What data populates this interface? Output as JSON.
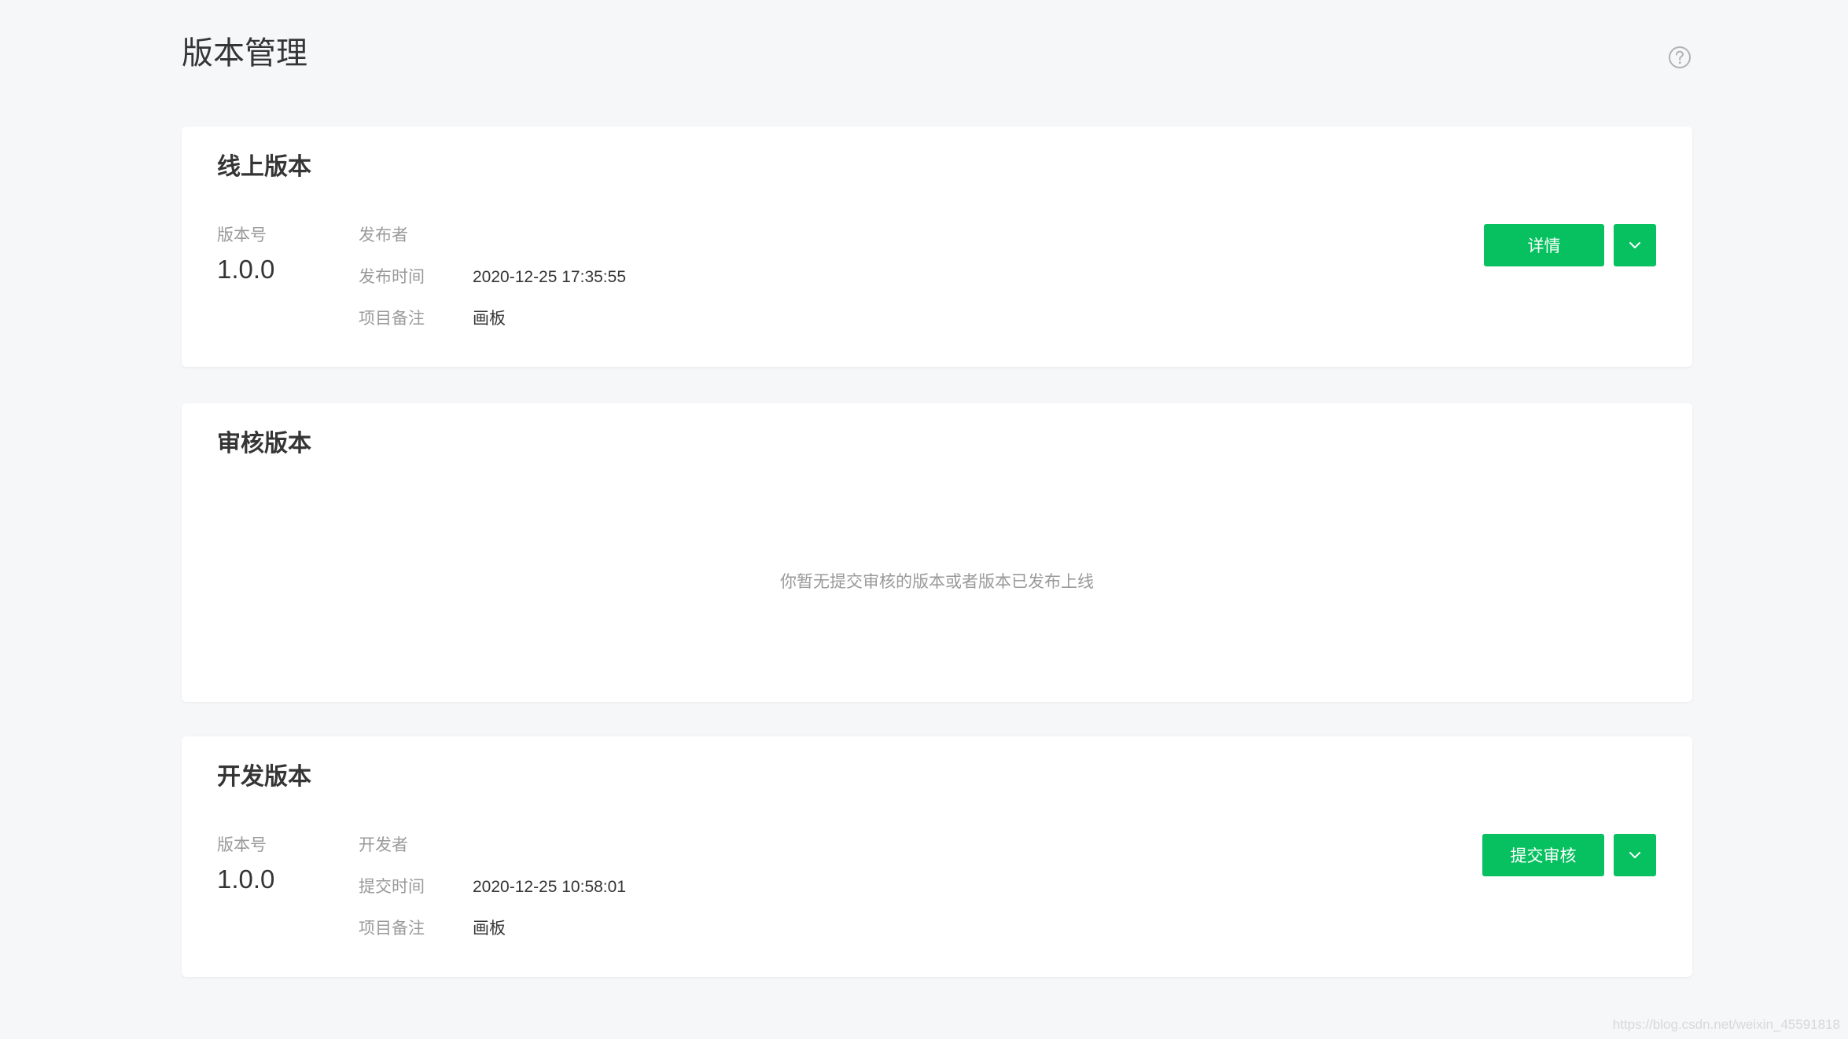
{
  "page": {
    "title": "版本管理",
    "help_icon": "question-circle-icon"
  },
  "online": {
    "title": "线上版本",
    "version_label": "版本号",
    "version": "1.0.0",
    "publisher_label": "发布者",
    "publisher": "",
    "time_label": "发布时间",
    "time": "2020-12-25 17:35:55",
    "note_label": "项目备注",
    "note": "画板",
    "detail_button": "详情"
  },
  "review": {
    "title": "审核版本",
    "empty_text": "你暂无提交审核的版本或者版本已发布上线"
  },
  "dev": {
    "title": "开发版本",
    "version_label": "版本号",
    "version": "1.0.0",
    "developer_label": "开发者",
    "developer": "",
    "time_label": "提交时间",
    "time": "2020-12-25 10:58:01",
    "note_label": "项目备注",
    "note": "画板",
    "submit_button": "提交审核"
  },
  "colors": {
    "primary": "#07c160",
    "background": "#f6f7f9",
    "text": "#353535",
    "muted": "#9a9a9a"
  },
  "watermark": "https://blog.csdn.net/weixin_45591818"
}
